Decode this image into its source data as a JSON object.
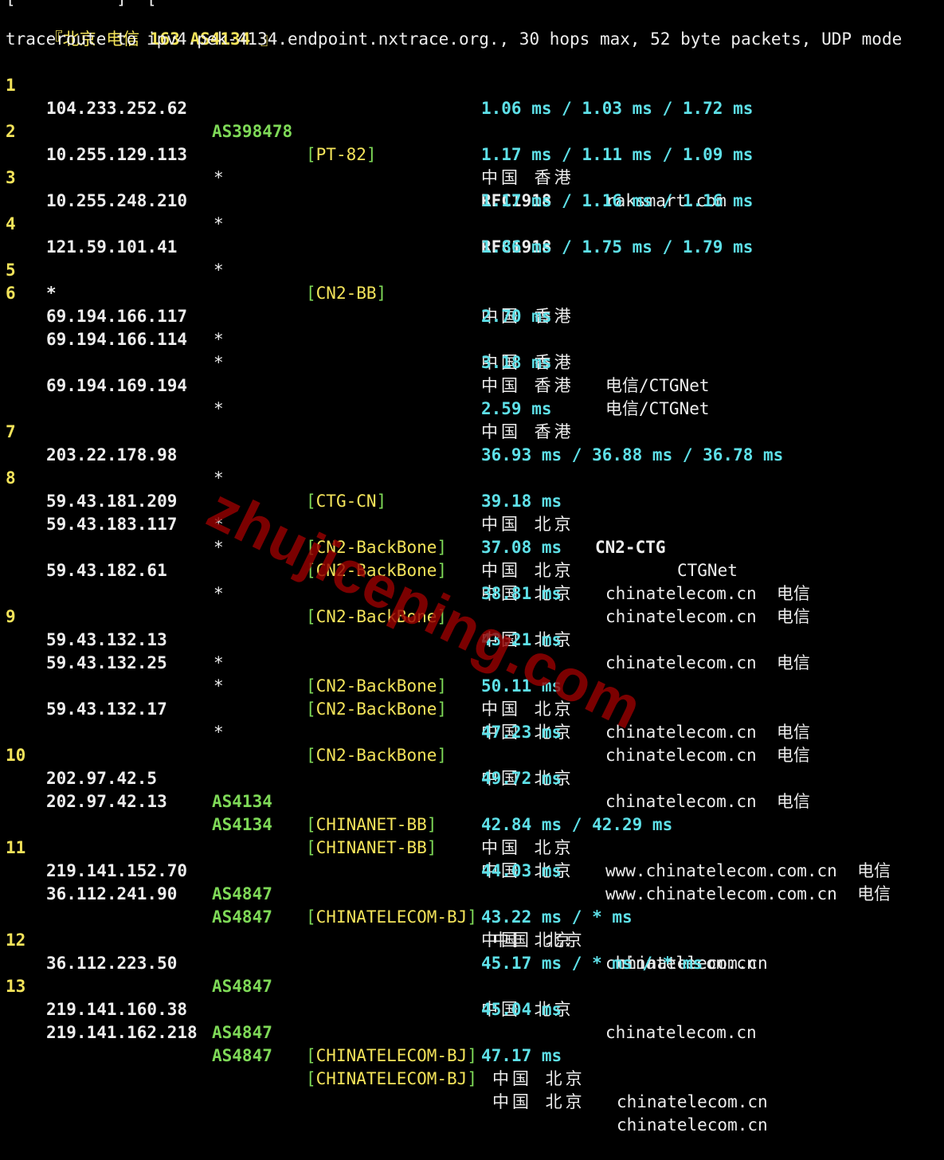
{
  "header": {
    "top_fragment": "[          ]  [",
    "target_label": "『北京 电信",
    "target_asn": "163 AS4134",
    "target_close": "』",
    "command": "traceroute to ipv4.pek-4134.endpoint.nxtrace.org., 30 hops max, 52 byte packets, UDP mode"
  },
  "hops": [
    {
      "hop": "1",
      "ip": "104.233.252.62",
      "asn": "AS398478",
      "tag": "PT-82",
      "geo": "中国 香港",
      "org": "raksmart.com",
      "rtt": "1.06 ms / 1.03 ms / 1.72 ms"
    },
    {
      "hop": "2",
      "ip": "10.255.129.113",
      "asn": "*",
      "tag": "",
      "geo": "RFC1918",
      "org": "",
      "rtt": "1.17 ms / 1.11 ms / 1.09 ms"
    },
    {
      "hop": "3",
      "ip": "10.255.248.210",
      "asn": "*",
      "tag": "",
      "geo": "RFC1918",
      "org": "",
      "rtt": "1.17 ms / 1.16 ms / 1.16 ms"
    },
    {
      "hop": "4",
      "ip": "121.59.101.41",
      "asn": "*",
      "tag": "CN2-BB",
      "geo": "中国 香港",
      "org": "",
      "rtt": "1.86 ms / 1.75 ms / 1.79 ms"
    },
    {
      "hop": "5",
      "ip": "*",
      "asn": "",
      "tag": "",
      "geo": "",
      "org": "",
      "rtt": ""
    },
    {
      "hop": "6",
      "ip": "69.194.166.117",
      "asn": "*",
      "tag": "",
      "geo": "中国 香港",
      "org": "电信/CTGNet",
      "rtt": "2.70 ms"
    },
    {
      "hop": "",
      "ip": "69.194.166.114",
      "asn": "*",
      "tag": "",
      "geo": "中国 香港",
      "org": "电信/CTGNet",
      "rtt": "3.18 ms"
    },
    {
      "hop": "",
      "ip": "69.194.169.194",
      "asn": "*",
      "tag": "",
      "geo": "中国 香港",
      "org": "",
      "rtt": "2.59 ms"
    },
    {
      "hop": "7",
      "ip": "203.22.178.98",
      "asn": "*",
      "tag": "CTG-CN",
      "geo": "中国 北京",
      "org_bold": "CN2-CTG",
      "org": "CTGNet",
      "rtt": "36.93 ms / 36.88 ms / 36.78 ms"
    },
    {
      "hop": "8",
      "ip": "59.43.181.209",
      "asn": "*",
      "tag": "CN2-BackBone",
      "geo": "中国 北京",
      "org": "chinatelecom.cn  电信",
      "rtt": "39.18 ms"
    },
    {
      "hop": "",
      "ip": "59.43.183.117",
      "asn": "*",
      "tag": "CN2-BackBone",
      "geo": "中国 北京",
      "org": "chinatelecom.cn  电信",
      "rtt": "37.08 ms"
    },
    {
      "hop": "",
      "ip": "59.43.182.61",
      "asn": "*",
      "tag": "CN2-BackBone",
      "geo": "中国 北京",
      "org": "chinatelecom.cn  电信",
      "rtt": "38.81 ms"
    },
    {
      "hop": "9",
      "ip": "59.43.132.13",
      "asn": "*",
      "tag": "CN2-BackBone",
      "geo": "中国 北京",
      "org": "chinatelecom.cn  电信",
      "rtt": "43.21 ms"
    },
    {
      "hop": "",
      "ip": "59.43.132.25",
      "asn": "*",
      "tag": "CN2-BackBone",
      "geo": "中国 北京",
      "org": "chinatelecom.cn  电信",
      "rtt": "50.11 ms"
    },
    {
      "hop": "",
      "ip": "59.43.132.17",
      "asn": "*",
      "tag": "CN2-BackBone",
      "geo": "中国 北京",
      "org": "chinatelecom.cn  电信",
      "rtt": "47.23 ms"
    },
    {
      "hop": "10",
      "ip": "202.97.42.5",
      "asn": "AS4134",
      "tag": "CHINANET-BB",
      "geo": "中国 北京",
      "org": "www.chinatelecom.com.cn  电信",
      "rtt": "49.72 ms"
    },
    {
      "hop": "",
      "ip": "202.97.42.13",
      "asn": "AS4134",
      "tag": "CHINANET-BB",
      "geo": "中国 北京",
      "org": "www.chinatelecom.com.cn  电信",
      "rtt": "42.84 ms / 42.29 ms"
    },
    {
      "hop": "11",
      "ip": "219.141.152.70",
      "asn": "AS4847",
      "tag": "CHINATELECOM-BJ",
      "geo": "中国 北京",
      "org": "chinatelecom.cn",
      "rtt": "44.03 ms"
    },
    {
      "hop": "",
      "ip": "36.112.241.90",
      "asn": "AS4847",
      "tag": "",
      "geo": "中国 北京",
      "org": "chinatelecom.cn",
      "rtt": "43.22 ms / * ms"
    },
    {
      "hop": "12",
      "ip": "36.112.223.50",
      "asn": "AS4847",
      "tag": "",
      "geo": "中国 北京",
      "org": "chinatelecom.cn",
      "rtt": "45.17 ms / * ms / * ms"
    },
    {
      "hop": "13",
      "ip": "219.141.160.38",
      "asn": "AS4847",
      "tag": "CHINATELECOM-BJ",
      "geo": "中国 北京",
      "org": "chinatelecom.cn",
      "rtt": "45.04 ms"
    },
    {
      "hop": "",
      "ip": "219.141.162.218",
      "asn": "AS4847",
      "tag": "CHINATELECOM-BJ",
      "geo": "中国 北京",
      "org": "chinatelecom.cn",
      "rtt": "47.17 ms"
    }
  ],
  "watermark": "zhujiceping.com",
  "colors": {
    "background": "#000000",
    "hop_number": "#f3e35a",
    "asn": "#7ed957",
    "tag": "#f3e35a",
    "rtt": "#5ee0e8",
    "text": "#ededed",
    "watermark": "#960000"
  }
}
